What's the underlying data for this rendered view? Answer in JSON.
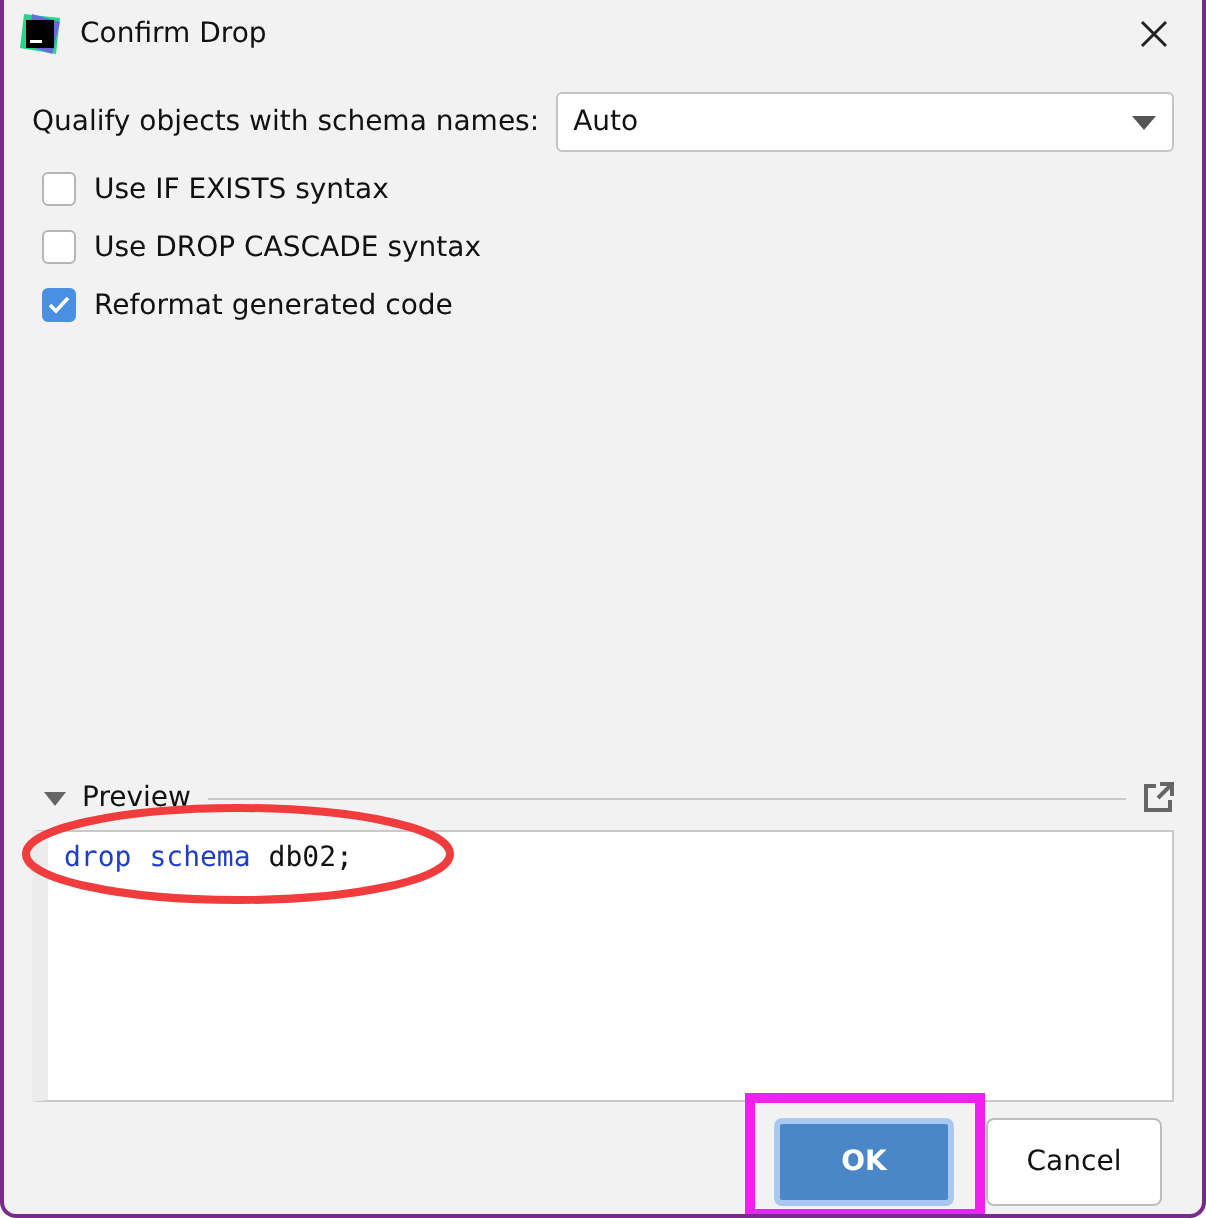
{
  "window": {
    "title": "Confirm Drop"
  },
  "qualify": {
    "label": "Qualify objects with schema names:",
    "value": "Auto"
  },
  "options": [
    {
      "label": "Use IF EXISTS syntax",
      "checked": false
    },
    {
      "label": "Use DROP CASCADE syntax",
      "checked": false
    },
    {
      "label": "Reformat generated code",
      "checked": true
    }
  ],
  "preview": {
    "title": "Preview",
    "expanded": true,
    "code": [
      {
        "text": "drop",
        "kind": "keyword"
      },
      {
        "text": "schema",
        "kind": "keyword"
      },
      {
        "text": "db02;",
        "kind": "plain"
      }
    ]
  },
  "buttons": [
    {
      "label": "OK",
      "kind": "primary"
    },
    {
      "label": "Cancel",
      "kind": "secondary"
    }
  ]
}
